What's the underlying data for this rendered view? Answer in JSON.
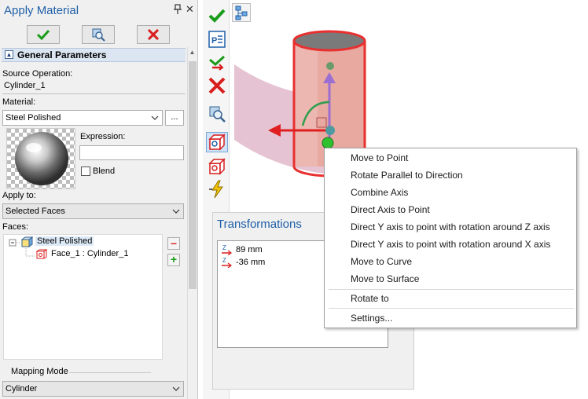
{
  "panel": {
    "title": "Apply Material",
    "pin_glyph": "📌",
    "close_glyph": "✕",
    "section_title": "General Parameters",
    "source_operation_label": "Source Operation:",
    "source_operation_value": "Cylinder_1",
    "material_label": "Material:",
    "material_value": "Steel Polished",
    "browse_label": "...",
    "expression_label": "Expression:",
    "expression_value": "",
    "blend_label": "Blend",
    "blend_checked": false,
    "apply_to_label": "Apply to:",
    "apply_to_value": "Selected Faces",
    "faces_label": "Faces:",
    "tree_root": "Steel Polished",
    "tree_child": "Face_1 : Cylinder_1",
    "mapping_mode_label": "Mapping Mode",
    "mapping_mode_value": "Cylinder"
  },
  "toolbar": {
    "icons": [
      "ok-check-icon",
      "parameters-icon",
      "redo-icon",
      "cancel-x-icon",
      "preview-icon",
      "box-select-icon",
      "box-icon",
      "lightning-icon"
    ]
  },
  "transformations": {
    "title": "Transformations",
    "items": [
      {
        "axis": "Z",
        "value": "89 mm"
      },
      {
        "axis": "Z",
        "value": "-36 mm"
      }
    ]
  },
  "context_menu": {
    "items": [
      "Move to Point",
      "Rotate Parallel to Direction",
      "Combine Axis",
      "Direct Axis to Point",
      "Direct Y axis to point with rotation around Z axis",
      "Direct Y axis to point with rotation around X axis",
      "Move to Curve",
      "Move to Surface",
      "Rotate to",
      "Settings..."
    ]
  },
  "colors": {
    "accent_blue": "#1f5fa8",
    "ok_green": "#1a9c1a",
    "cancel_red": "#d81e1e",
    "cylinder": "#e8a9a0",
    "cylinder_edge": "#e83030"
  }
}
